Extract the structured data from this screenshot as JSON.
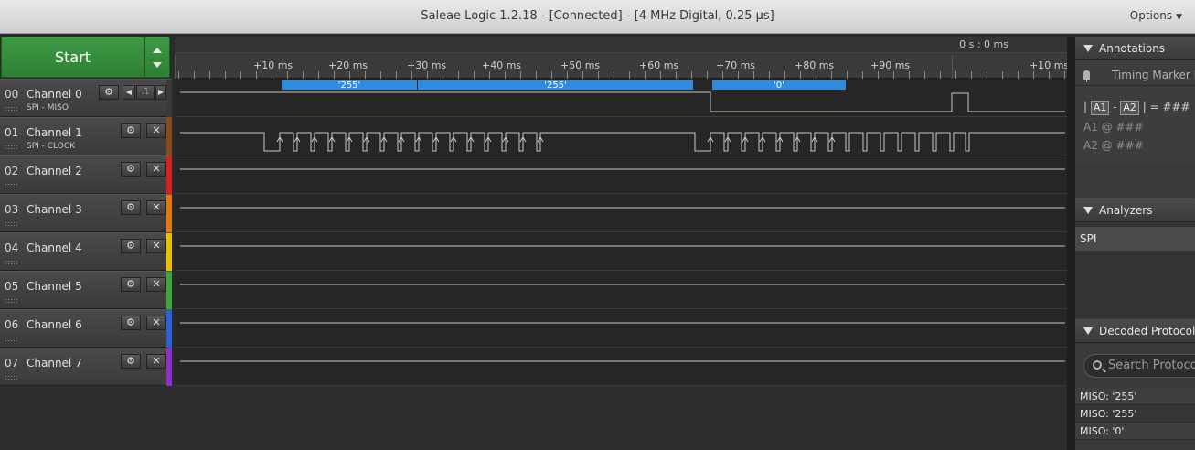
{
  "window": {
    "title": "Saleae Logic 1.2.18 - [Connected] - [4 MHz Digital, 0.25 µs]",
    "options_label": "Options"
  },
  "start_button": {
    "label": "Start"
  },
  "ruler": {
    "origin_label": "0 s : 0 ms",
    "ticks": [
      "+10 ms",
      "+20 ms",
      "+30 ms",
      "+40 ms",
      "+50 ms",
      "+60 ms",
      "+70 ms",
      "+80 ms",
      "+90 ms",
      "+10 ms"
    ]
  },
  "channels": [
    {
      "num": "00",
      "name": "Channel 0",
      "sub": "SPI - MISO",
      "color": "#3a3a3a"
    },
    {
      "num": "01",
      "name": "Channel 1",
      "sub": "SPI - CLOCK",
      "color": "#8b4a1e"
    },
    {
      "num": "02",
      "name": "Channel 2",
      "sub": "",
      "color": "#d42020"
    },
    {
      "num": "03",
      "name": "Channel 3",
      "sub": "",
      "color": "#e07a10"
    },
    {
      "num": "04",
      "name": "Channel 4",
      "sub": "",
      "color": "#e8c000"
    },
    {
      "num": "05",
      "name": "Channel 5",
      "sub": "",
      "color": "#3fa63f"
    },
    {
      "num": "06",
      "name": "Channel 6",
      "sub": "",
      "color": "#2f5fd6"
    },
    {
      "num": "07",
      "name": "Channel 7",
      "sub": "",
      "color": "#8a2fc8"
    }
  ],
  "decoded_bubbles": [
    "'255'",
    "'255'",
    "'0'"
  ],
  "annotations": {
    "title": "Annotations",
    "timing_marker": "Timing Marker P",
    "marker_a1": "A1",
    "marker_a2": "A2",
    "diff_value": "###",
    "a1_label": "A1",
    "a1_value": "###",
    "a2_label": "A2",
    "a2_value": "###"
  },
  "analyzers": {
    "title": "Analyzers",
    "items": [
      "SPI"
    ]
  },
  "decoded_protocols": {
    "title": "Decoded Protocols",
    "search_placeholder": "Search Protoco",
    "items": [
      "MISO: '255'",
      "MISO: '255'",
      "MISO: '0'"
    ]
  },
  "colors": {
    "accent_green": "#2f8a36",
    "bubble_blue": "#2e8be0",
    "trace": "#c8c8c8"
  }
}
